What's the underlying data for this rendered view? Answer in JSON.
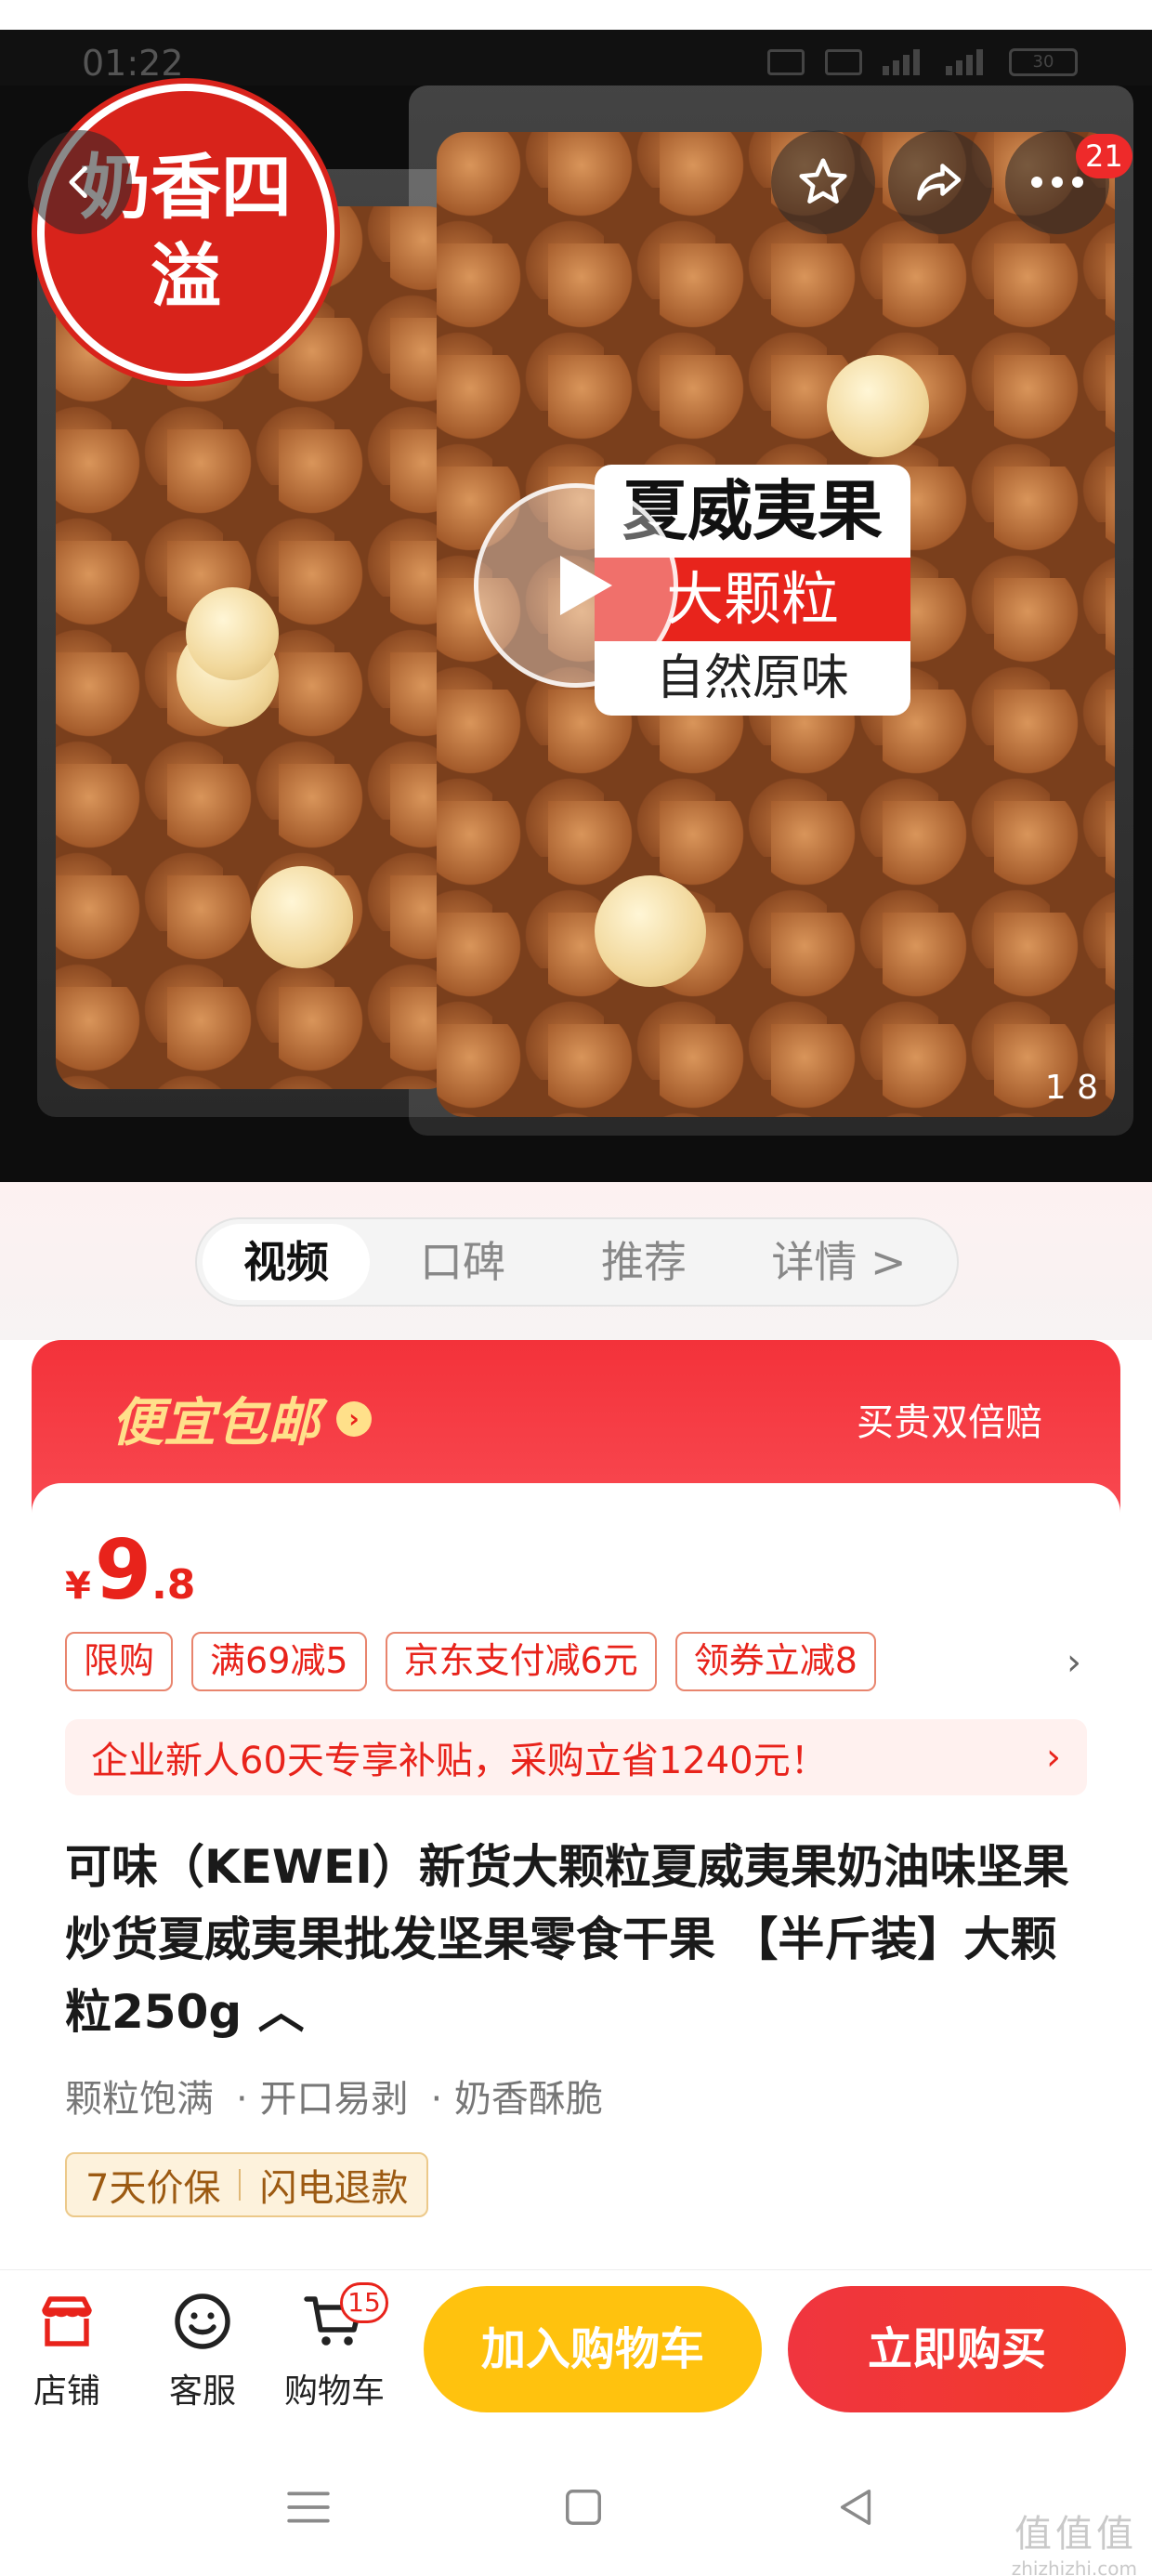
{
  "status_bar": {
    "time": "01:22",
    "battery": "30"
  },
  "hero": {
    "badge_text": "奶香四溢",
    "label_line1": "夏威夷果",
    "label_line2": "大颗粒",
    "label_line3": "自然原味",
    "more_badge_count": "21",
    "page_indicator": "1  8"
  },
  "tabs": [
    {
      "label": "视频",
      "active": true
    },
    {
      "label": "口碑",
      "active": false
    },
    {
      "label": "推荐",
      "active": false
    },
    {
      "label": "详情 >",
      "active": false
    }
  ],
  "promo": {
    "left_text": "便宜包邮",
    "right_text": "买贵双倍赔"
  },
  "price": {
    "currency": "¥",
    "integer": "9",
    "decimal": ".8"
  },
  "promo_tags": [
    "限购",
    "满69减5",
    "京东支付减6元",
    "领券立减8"
  ],
  "notice": {
    "text": "企业新人60天专享补贴，采购立省1240元！",
    "chevron": "›"
  },
  "product": {
    "title": "可味（KEWEI）新货大颗粒夏威夷果奶油味坚果炒货夏威夷果批发坚果零食干果 【半斤装】大颗粒250g ︿",
    "features": [
      "颗粒饱满",
      "· 开口易剥",
      "· 奶香酥脆"
    ],
    "guarantee_1": "7天价保",
    "guarantee_2": "闪电退款"
  },
  "bottom_bar": {
    "store_label": "店铺",
    "service_label": "客服",
    "cart_label": "购物车",
    "cart_count": "15",
    "add_to_cart": "加入购物车",
    "buy_now": "立即购买"
  },
  "watermark": {
    "main": "值值值",
    "url": "zhizhizhi.com"
  },
  "colors": {
    "accent_red": "#e8231b",
    "cart_yellow": "#ffc20e",
    "promo_yellow": "#ffe08a"
  }
}
